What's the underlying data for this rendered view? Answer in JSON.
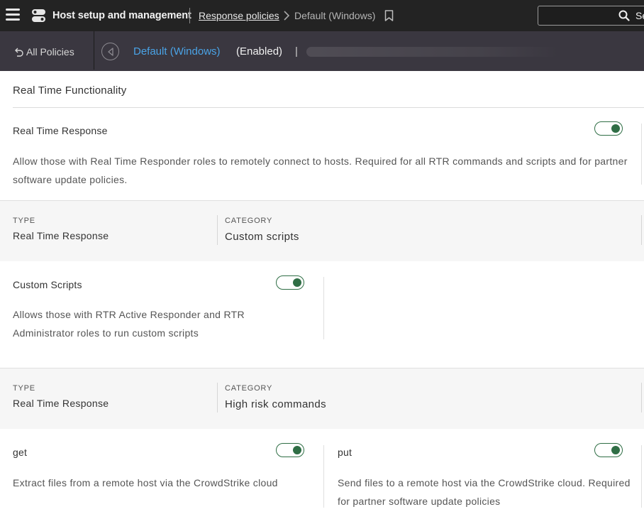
{
  "topbar": {
    "app_title": "Host setup and management",
    "breadcrumb_link": "Response policies",
    "breadcrumb_current": "Default (Windows)",
    "search_text": "Se"
  },
  "subbar": {
    "all_policies": "All Policies",
    "policy_name": "Default (Windows)",
    "policy_status": "(Enabled)",
    "separator": "|"
  },
  "section": {
    "title": "Real Time Functionality"
  },
  "rtr": {
    "name": "Real Time Response",
    "enabled": true,
    "description": "Allow those with Real Time Responder roles to remotely connect to hosts. Required for all RTR commands and scripts and for partner software update policies."
  },
  "meta1": {
    "type_label": "TYPE",
    "type_value": "Real Time Response",
    "category_label": "CATEGORY",
    "category_value": "Custom scripts"
  },
  "custom_scripts": {
    "name": "Custom Scripts",
    "enabled": true,
    "description": "Allows those with RTR Active Responder and RTR Administrator roles to run custom scripts"
  },
  "meta2": {
    "type_label": "TYPE",
    "type_value": "Real Time Response",
    "category_label": "CATEGORY",
    "category_value": "High risk commands"
  },
  "get": {
    "name": "get",
    "enabled": true,
    "description": "Extract files from a remote host via the CrowdStrike cloud"
  },
  "put": {
    "name": "put",
    "enabled": true,
    "description": "Send files to a remote host via the CrowdStrike cloud. Required for partner software update policies"
  },
  "colors": {
    "topbar_bg": "#232323",
    "subbar_bg": "#3a3740",
    "policy_link": "#4aa3e6",
    "toggle_on": "#2f6e45",
    "meta_band_bg": "#f6f6f6"
  }
}
